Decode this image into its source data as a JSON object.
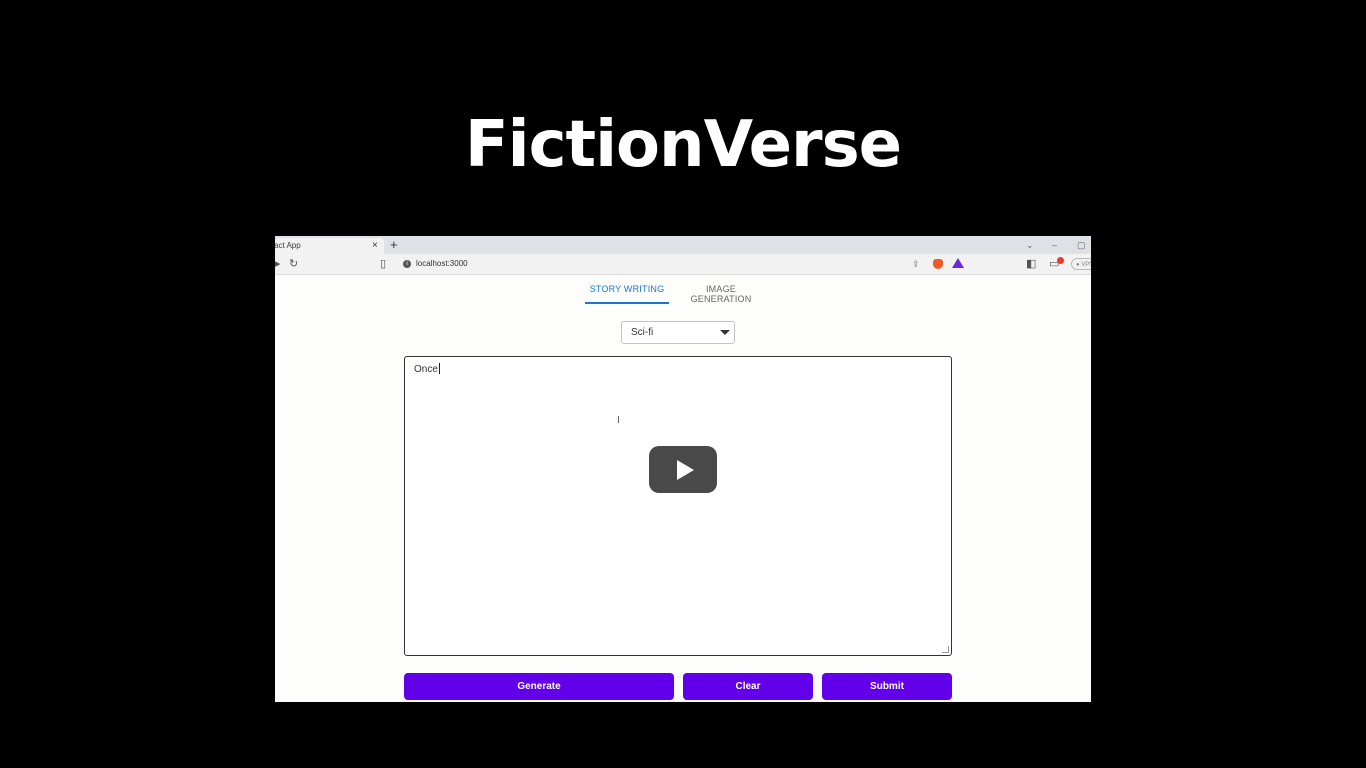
{
  "video": {
    "title": "FictionVerse"
  },
  "browser": {
    "tab_title": "act App",
    "tab_close": "×",
    "new_tab": "+",
    "url": "localhost:3000",
    "vpn_label": "● VPN",
    "window_controls": [
      "⌄",
      "–",
      "▢"
    ]
  },
  "app": {
    "tabs": [
      {
        "label": "STORY WRITING",
        "active": true
      },
      {
        "label": "IMAGE GENERATION",
        "active": false
      }
    ],
    "genre": {
      "selected": "Sci-fi"
    },
    "story": {
      "text": "Once"
    },
    "buttons": {
      "generate": "Generate",
      "clear": "Clear",
      "submit": "Submit"
    }
  },
  "colors": {
    "accent": "#6200ea",
    "tab_active": "#1976d2",
    "backdrop": "#000000"
  }
}
